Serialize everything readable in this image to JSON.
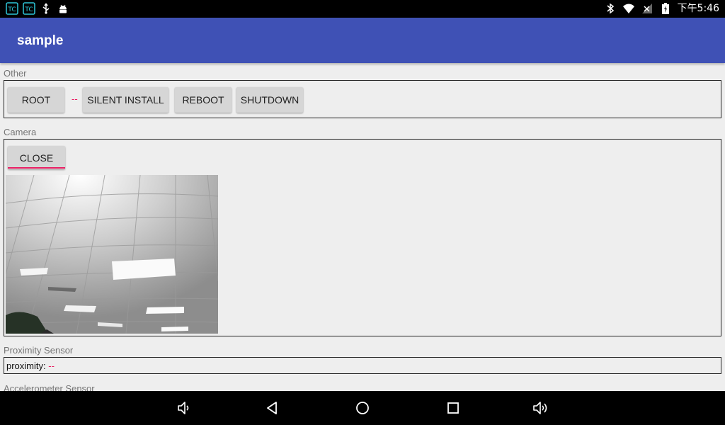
{
  "status_bar": {
    "left_icons": [
      "app-icon",
      "app-icon",
      "usb-icon",
      "android-debug-icon"
    ],
    "right_icons": [
      "bluetooth-icon",
      "wifi-icon",
      "signal-icon",
      "battery-charging-icon"
    ],
    "time": "下午5:46"
  },
  "app_bar": {
    "title": "sample"
  },
  "other": {
    "label": "Other",
    "buttons": {
      "root": "ROOT",
      "silent_install": "SILENT INSTALL",
      "reboot": "REBOOT",
      "shutdown": "SHUTDOWN"
    },
    "root_status": "--"
  },
  "camera": {
    "label": "Camera",
    "close_button": "CLOSE",
    "preview": "camera-preview"
  },
  "proximity": {
    "label": "Proximity Sensor",
    "prefix": "proximity:",
    "value": "--"
  },
  "accelerometer": {
    "label": "Accelerometer Sensor"
  },
  "nav_bar": {
    "icons": [
      "volume-down-icon",
      "back-icon",
      "home-icon",
      "recents-icon",
      "volume-up-icon"
    ]
  },
  "colors": {
    "app_bar": "#3f51b5",
    "accent": "#e91e63",
    "background": "#eeeeee",
    "button": "#d6d6d6"
  }
}
